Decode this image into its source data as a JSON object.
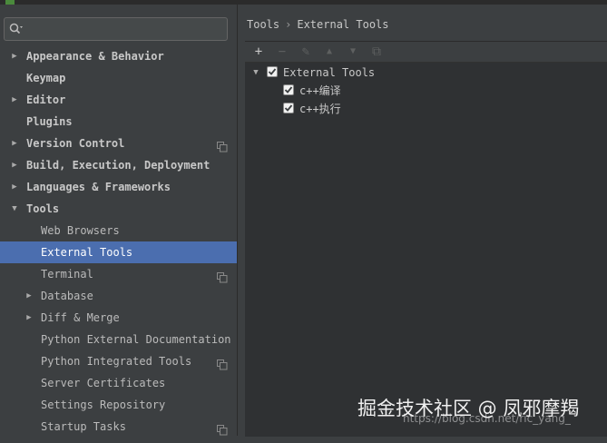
{
  "window": {
    "title_fragment": ""
  },
  "search": {
    "value": "",
    "placeholder": ""
  },
  "sidebar": {
    "items": [
      {
        "label": "Appearance & Behavior",
        "level": 0,
        "arrow": "right"
      },
      {
        "label": "Keymap",
        "level": 0,
        "arrow": "none"
      },
      {
        "label": "Editor",
        "level": 0,
        "arrow": "right"
      },
      {
        "label": "Plugins",
        "level": 0,
        "arrow": "none"
      },
      {
        "label": "Version Control",
        "level": 0,
        "arrow": "right",
        "icon": "copy-icon"
      },
      {
        "label": "Build, Execution, Deployment",
        "level": 0,
        "arrow": "right"
      },
      {
        "label": "Languages & Frameworks",
        "level": 0,
        "arrow": "right"
      },
      {
        "label": "Tools",
        "level": 0,
        "arrow": "down"
      },
      {
        "label": "Web Browsers",
        "level": 1,
        "arrow": "none"
      },
      {
        "label": "External Tools",
        "level": 1,
        "arrow": "none",
        "selected": true
      },
      {
        "label": "Terminal",
        "level": 1,
        "arrow": "none",
        "icon": "copy-icon"
      },
      {
        "label": "Database",
        "level": 1,
        "arrow": "right"
      },
      {
        "label": "Diff & Merge",
        "level": 1,
        "arrow": "right"
      },
      {
        "label": "Python External Documentation",
        "level": 1,
        "arrow": "none"
      },
      {
        "label": "Python Integrated Tools",
        "level": 1,
        "arrow": "none",
        "icon": "copy-icon"
      },
      {
        "label": "Server Certificates",
        "level": 1,
        "arrow": "none"
      },
      {
        "label": "Settings Repository",
        "level": 1,
        "arrow": "none"
      },
      {
        "label": "Startup Tasks",
        "level": 1,
        "arrow": "none",
        "icon": "copy-icon"
      }
    ]
  },
  "breadcrumb": {
    "parent": "Tools",
    "separator": "›",
    "current": "External Tools"
  },
  "toolbar": {
    "add": {
      "glyph": "+",
      "icon": "plus-icon",
      "enabled": true
    },
    "remove": {
      "glyph": "−",
      "icon": "minus-icon",
      "enabled": false
    },
    "edit": {
      "glyph": "✎",
      "icon": "pencil-icon",
      "enabled": false
    },
    "move_up": {
      "glyph": "▲",
      "icon": "arrow-up-icon",
      "enabled": false
    },
    "move_down": {
      "glyph": "▼",
      "icon": "arrow-down-icon",
      "enabled": false
    },
    "copy": {
      "glyph": "⧉",
      "icon": "copy-icon",
      "enabled": false
    }
  },
  "external_tools": {
    "group": {
      "label": "External Tools",
      "checked": true,
      "expanded": true
    },
    "tools": [
      {
        "label": "c++编译",
        "checked": true
      },
      {
        "label": "c++执行",
        "checked": true
      }
    ]
  },
  "watermark": {
    "text": "掘金技术社区 @ 凤邪摩羯",
    "url": "https://blog.csdn.net/ric_yang_"
  },
  "colors": {
    "background": "#3c3f41",
    "panel": "#2f3133",
    "selection": "#4b6eaf",
    "text": "#bbbbbb"
  }
}
